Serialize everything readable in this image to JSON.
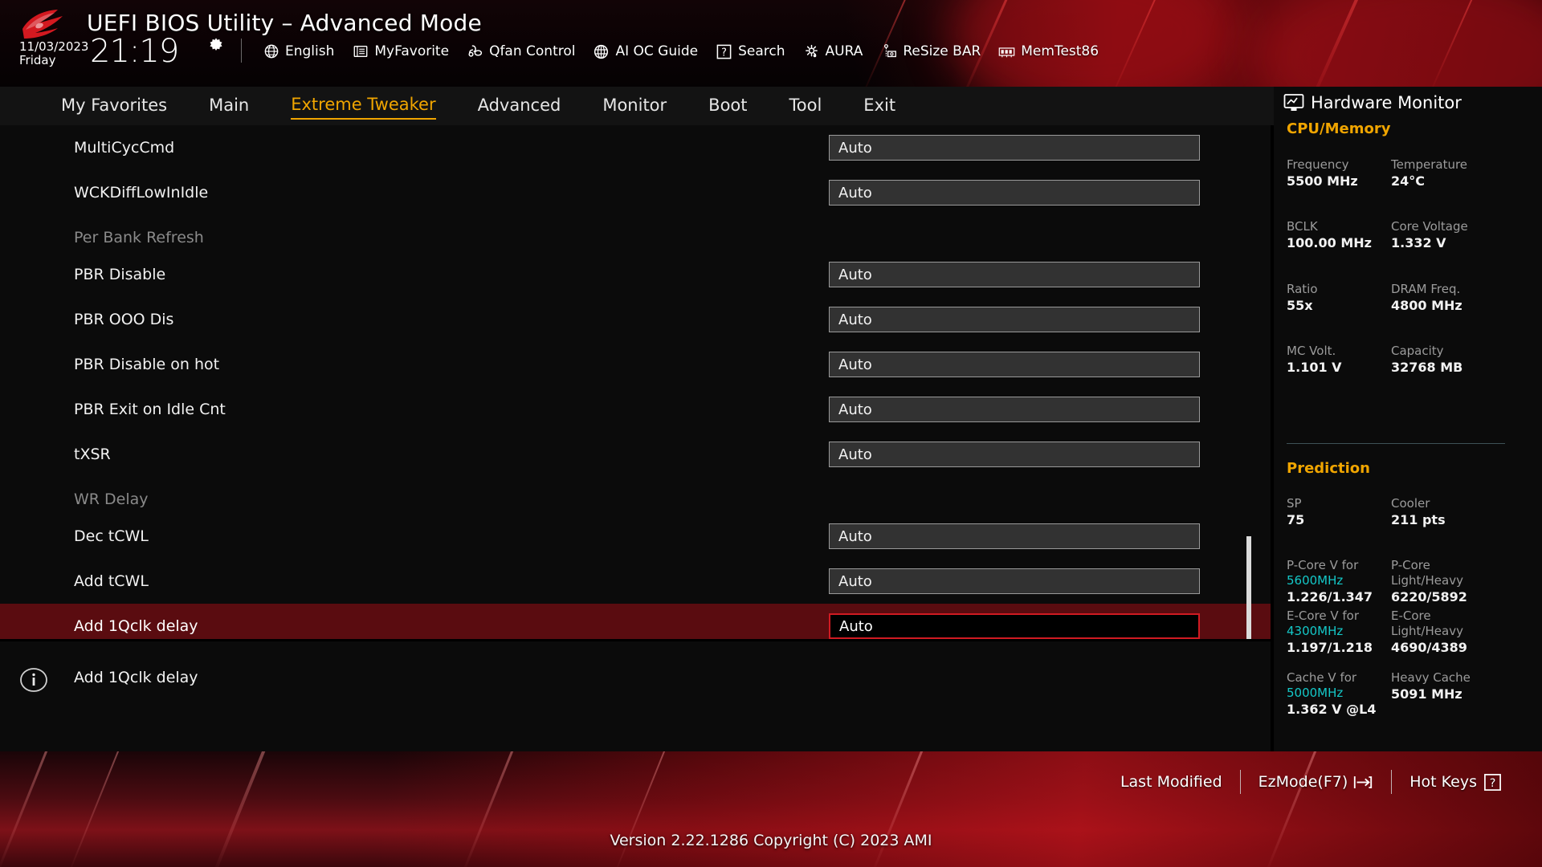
{
  "header": {
    "title": "UEFI BIOS Utility – Advanced Mode",
    "date": "11/03/2023",
    "day": "Friday",
    "time": "21:19",
    "gear_icon": "gear-icon",
    "toolbar": [
      {
        "icon": "globe-icon",
        "label": "English"
      },
      {
        "icon": "favorites-icon",
        "label": "MyFavorite"
      },
      {
        "icon": "fan-icon",
        "label": "Qfan Control"
      },
      {
        "icon": "aioc-icon",
        "label": "AI OC Guide"
      },
      {
        "icon": "question-icon",
        "label": "Search"
      },
      {
        "icon": "aura-icon",
        "label": "AURA"
      },
      {
        "icon": "resizebar-icon",
        "label": "ReSize BAR"
      },
      {
        "icon": "memtest-icon",
        "label": "MemTest86"
      }
    ]
  },
  "nav": {
    "tabs": [
      {
        "label": "My Favorites",
        "active": false
      },
      {
        "label": "Main",
        "active": false
      },
      {
        "label": "Extreme Tweaker",
        "active": true
      },
      {
        "label": "Advanced",
        "active": false
      },
      {
        "label": "Monitor",
        "active": false
      },
      {
        "label": "Boot",
        "active": false
      },
      {
        "label": "Tool",
        "active": false
      },
      {
        "label": "Exit",
        "active": false
      }
    ]
  },
  "settings": {
    "rows": [
      {
        "label": "MultiCycCmd",
        "value": "Auto",
        "dim": false,
        "selected": false,
        "has_field": true
      },
      {
        "label": "WCKDiffLowInIdle",
        "value": "Auto",
        "dim": false,
        "selected": false,
        "has_field": true
      },
      {
        "label": "Per Bank Refresh",
        "value": "",
        "dim": true,
        "selected": false,
        "has_field": false
      },
      {
        "label": "PBR Disable",
        "value": "Auto",
        "dim": false,
        "selected": false,
        "has_field": true
      },
      {
        "label": "PBR OOO Dis",
        "value": "Auto",
        "dim": false,
        "selected": false,
        "has_field": true
      },
      {
        "label": "PBR Disable on hot",
        "value": "Auto",
        "dim": false,
        "selected": false,
        "has_field": true
      },
      {
        "label": "PBR Exit on Idle Cnt",
        "value": "Auto",
        "dim": false,
        "selected": false,
        "has_field": true
      },
      {
        "label": "tXSR",
        "value": "Auto",
        "dim": false,
        "selected": false,
        "has_field": true
      },
      {
        "label": "WR Delay",
        "value": "",
        "dim": true,
        "selected": false,
        "has_field": false
      },
      {
        "label": "Dec tCWL",
        "value": "Auto",
        "dim": false,
        "selected": false,
        "has_field": true
      },
      {
        "label": "Add tCWL",
        "value": "Auto",
        "dim": false,
        "selected": false,
        "has_field": true
      },
      {
        "label": "Add 1Qclk delay",
        "value": "Auto",
        "dim": false,
        "selected": true,
        "has_field": true
      }
    ]
  },
  "help": {
    "icon": "info-icon",
    "text": "Add 1Qclk delay"
  },
  "hardware_monitor": {
    "icon": "monitor-icon",
    "title": "Hardware Monitor",
    "cpu_memory": {
      "section_label": "CPU/Memory",
      "items": [
        {
          "key": "Frequency",
          "value": "5500 MHz"
        },
        {
          "key": "Temperature",
          "value": "24°C"
        },
        {
          "key": "BCLK",
          "value": "100.00 MHz"
        },
        {
          "key": "Core Voltage",
          "value": "1.332 V"
        },
        {
          "key": "Ratio",
          "value": "55x"
        },
        {
          "key": "DRAM Freq.",
          "value": "4800 MHz"
        },
        {
          "key": "MC Volt.",
          "value": "1.101 V"
        },
        {
          "key": "Capacity",
          "value": "32768 MB"
        }
      ]
    },
    "prediction": {
      "section_label": "Prediction",
      "items": [
        {
          "key": "SP",
          "value": "75"
        },
        {
          "key": "Cooler",
          "value": "211 pts"
        }
      ],
      "cores": [
        {
          "key": "P-Core V for",
          "key2": "5600MHz",
          "key2_color": "#14c8c8",
          "value": "1.226/1.347"
        },
        {
          "key": "P-Core",
          "key2": "Light/Heavy",
          "key2_color": "#9b9b9b",
          "value": "6220/5892"
        },
        {
          "key": "E-Core V for",
          "key2": "4300MHz",
          "key2_color": "#14c8c8",
          "value": "1.197/1.218"
        },
        {
          "key": "E-Core",
          "key2": "Light/Heavy",
          "key2_color": "#9b9b9b",
          "value": "4690/4389"
        },
        {
          "key": "Cache V for",
          "key2": "5000MHz",
          "key2_color": "#14c8c8",
          "value": "1.362 V @L4"
        },
        {
          "key": "Heavy Cache",
          "key2": "5091 MHz",
          "key2_color": "#f2f2f2",
          "value": ""
        }
      ]
    }
  },
  "footer": {
    "actions": [
      {
        "label": "Last Modified",
        "icon": ""
      },
      {
        "label": "EzMode(F7)",
        "icon": "arrow-right-icon"
      },
      {
        "label": "Hot Keys",
        "icon": "question-box-icon"
      }
    ],
    "version": "Version 2.22.1286 Copyright (C) 2023 AMI"
  },
  "colors": {
    "accent_yellow": "#f0a500",
    "accent_cyan": "#14c8c8",
    "selection_red": "#5a0c10",
    "selection_border": "#d01a22"
  }
}
